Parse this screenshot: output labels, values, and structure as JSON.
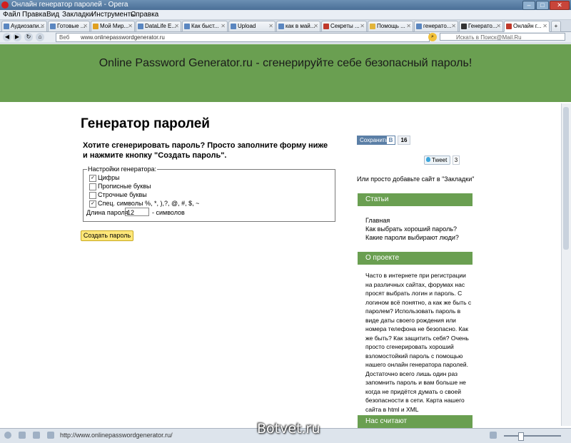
{
  "window": {
    "title": "Онлайн генератор паролей - Opera"
  },
  "menu": [
    "Файл",
    "Правка",
    "Вид",
    "Закладки",
    "Инструменты",
    "Справка"
  ],
  "tabs": [
    {
      "label": "Аудиозапи..."
    },
    {
      "label": "Готовые ..."
    },
    {
      "label": "Мой Мир..."
    },
    {
      "label": "DataLife E..."
    },
    {
      "label": "Как быст..."
    },
    {
      "label": "Upload"
    },
    {
      "label": "как в май..."
    },
    {
      "label": "Секреты ..."
    },
    {
      "label": "Помощь ..."
    },
    {
      "label": "генерато..."
    },
    {
      "label": "Генерато..."
    },
    {
      "label": "Онлайн г..."
    }
  ],
  "address": {
    "tab_label": "Веб",
    "url": "www.onlinepasswordgenerator.ru",
    "search_placeholder": "Искать в Поиск@Mail.Ru"
  },
  "page": {
    "banner": "Online Password Generator.ru - сгенерируйте себе безопасный пароль!",
    "heading": "Генератор паролей",
    "subheading": "Хотите сгенерировать пароль? Просто заполните форму ниже и нажмите кнопку \"Создать пароль\".",
    "legend": "Настройки генератора:",
    "options": [
      {
        "label": "Цифры",
        "checked": true,
        "mark": "✓"
      },
      {
        "label": "Прописные буквы",
        "checked": false,
        "mark": ""
      },
      {
        "label": "Строчные буквы",
        "checked": false,
        "mark": ""
      },
      {
        "label": "Спец. символы %, *, ),?, @, #, $, ~",
        "checked": true,
        "mark": "✓"
      }
    ],
    "length_label": "Длина пароля",
    "length_value": "12",
    "length_suffix": "- символов",
    "create_button": "Создать пароль"
  },
  "sidebar": {
    "vk_label": "Сохранить",
    "vk_icon": "В",
    "vk_count": "16",
    "tweet_label": "Tweet",
    "tweet_count": "3",
    "bookmark_text": "Или просто добавьте сайт в \"Закладки\"",
    "articles_title": "Статьи",
    "articles": [
      "Главная",
      "Как выбрать хороший пароль?",
      "Какие пароли выбирают люди?"
    ],
    "about_title": "О проекте",
    "about_text": "Часто в интернете при регистрации на различных сайтах, форумах нас просят выбрать логин и пароль. С логином всё понятно, а как же быть с паролем? Использовать пароль в виде даты своего рождения или номера телефона не безопасно. Как же быть? Как защитить себя? Очень просто сгенерировать хороший взломостойкий пароль с помощью нашего онлайн генератора паролей. Достаточно всего лишь один раз запомнить пароль и вам больше не когда не придётся думать о своей безопасности в сети. Карта нашего сайта в html и XML",
    "count_title": "Нас считают"
  },
  "status": {
    "url": "http://www.onlinepasswordgenerator.ru/"
  },
  "watermark": "Botvet.ru",
  "colors": {
    "banner": "#6a9f51",
    "button": "#ffe77a"
  }
}
